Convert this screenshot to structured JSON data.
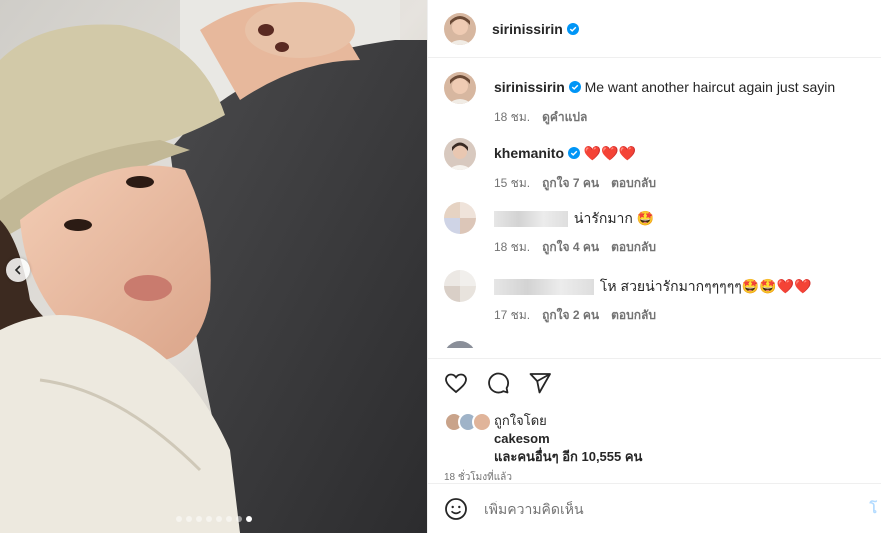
{
  "post": {
    "author": "sirinissirin",
    "carousel": {
      "total_slides": 8,
      "active_slide": 8
    }
  },
  "caption": {
    "author": "sirinissirin",
    "text": "Me want another haircut again just sayin",
    "time": "18 ชม.",
    "translate": "ดูคำแปล"
  },
  "comments": [
    {
      "author": "khemanito",
      "verified": true,
      "text": "❤️❤️❤️",
      "time": "15 ชม.",
      "likes": "ถูกใจ 7 คน",
      "reply": "ตอบกลับ"
    },
    {
      "author": "",
      "blurred": true,
      "text": "น่ารักมาก 🤩",
      "time": "18 ชม.",
      "likes": "ถูกใจ 4 คน",
      "reply": "ตอบกลับ"
    },
    {
      "author": "",
      "blurred": true,
      "text": "โห สวยน่ารักมากๆๆๆๆๆ🤩🤩❤️❤️",
      "time": "17 ชม.",
      "likes": "ถูกใจ 2 คน",
      "reply": "ตอบกลับ"
    }
  ],
  "actions": {
    "like_icon": "heart-icon",
    "comment_icon": "comment-icon",
    "share_icon": "share-icon"
  },
  "liked_by": {
    "label": "ถูกใจโดย",
    "user": "cakesom",
    "others": "และคนอื่นๆ อีก 10,555 คน"
  },
  "timestamp": "18 ชั่วโมงที่แล้ว",
  "add_comment": {
    "placeholder": "เพิ่มความคิดเห็น",
    "post_label": "โ"
  },
  "colors": {
    "verified": "#0095f6",
    "muted": "#737373",
    "heart": "#ed1c24"
  }
}
